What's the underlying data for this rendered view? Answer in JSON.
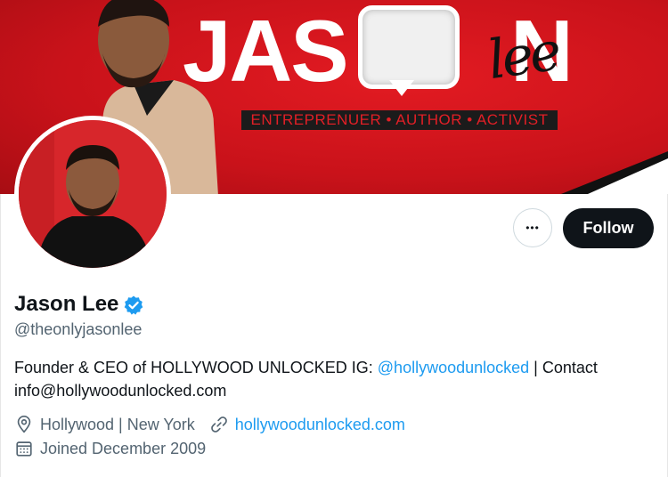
{
  "banner": {
    "title_left": "JAS",
    "title_right": "N",
    "signature": "lee",
    "tagline": "ENTREPRENUER • AUTHOR • ACTIVIST"
  },
  "actions": {
    "more_label": "•••",
    "follow_label": "Follow"
  },
  "profile": {
    "name": "Jason Lee",
    "handle": "@theonlyjasonlee",
    "bio_text": "Founder & CEO of HOLLYWOOD UNLOCKED IG: ",
    "bio_mention": "@hollywoodunlocked",
    "bio_tail": " | Contact info@hollywoodunlocked.com",
    "location": "Hollywood | New York",
    "website": "hollywoodunlocked.com",
    "joined": "Joined December 2009"
  },
  "colors": {
    "banner_red": "#d4141b",
    "link_blue": "#1d9bf0",
    "follow_bg": "#0f1419",
    "muted_text": "#536471"
  }
}
